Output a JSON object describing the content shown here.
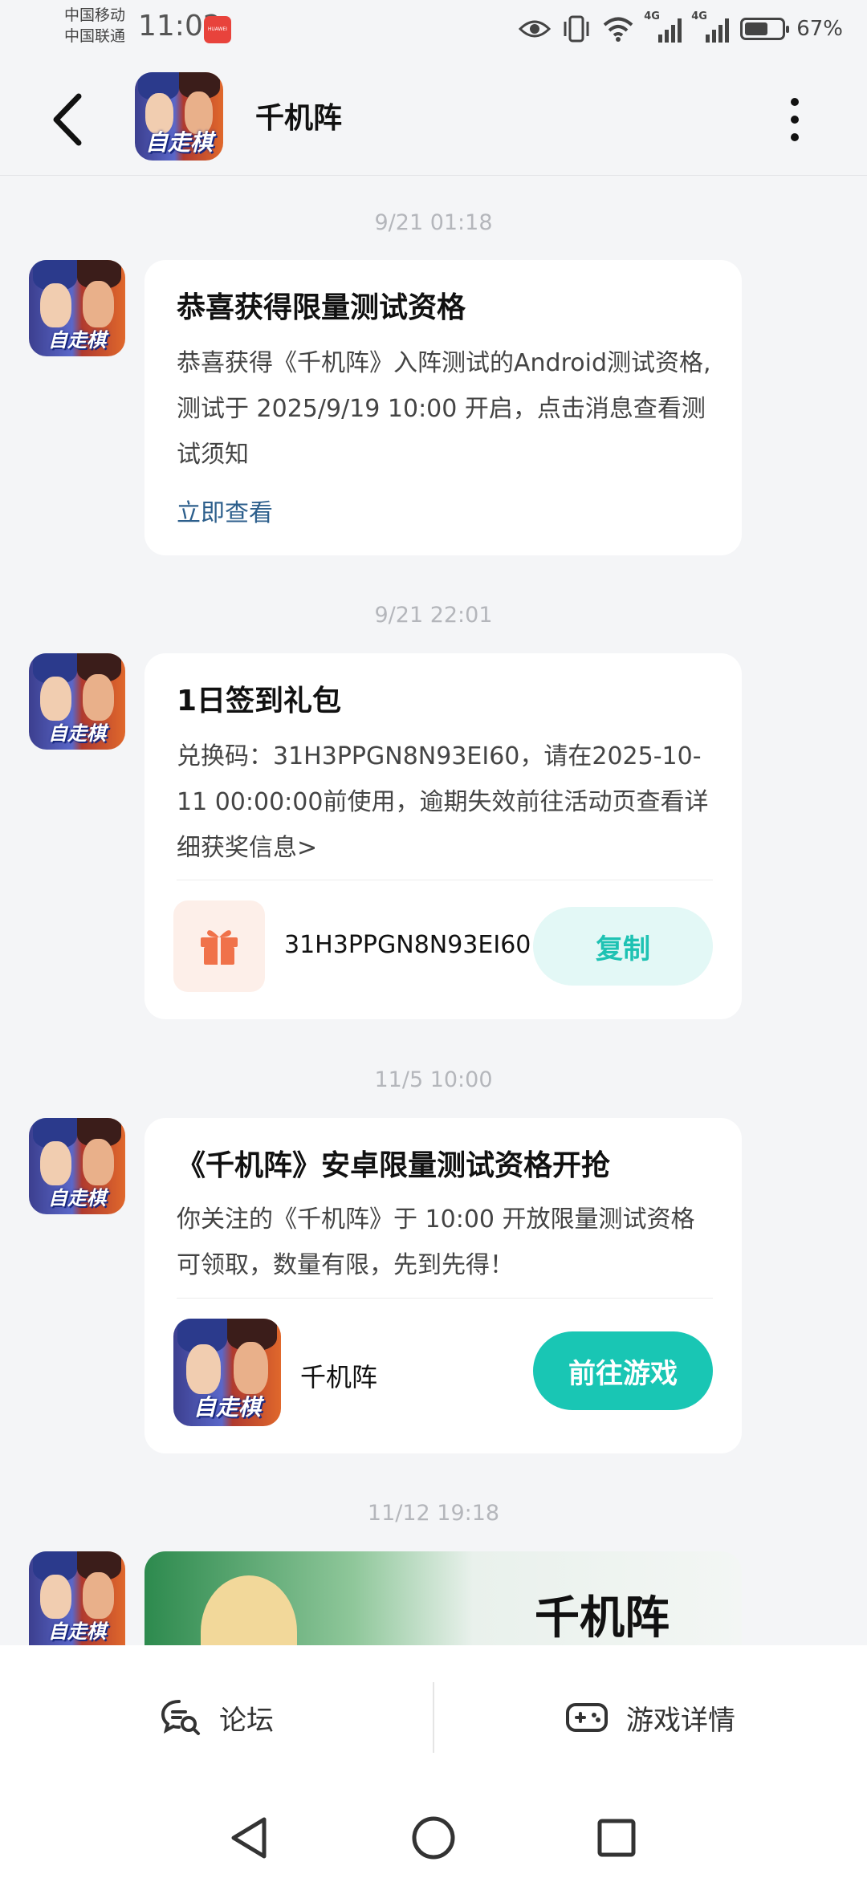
{
  "status_bar": {
    "carrier_1": "中国移动",
    "carrier_2": "中国联通",
    "time": "11:02",
    "badge": "HUAWEI",
    "network_1": "4G",
    "network_2": "4G",
    "battery": "67%",
    "battery_level": 0.67
  },
  "header": {
    "title": "千机阵",
    "icon_text": "自走棋"
  },
  "messages": [
    {
      "timestamp": "9/21  01:18",
      "title": "恭喜获得限量测试资格",
      "body": "恭喜获得《千机阵》入阵测试的Android测试资格,测试于 2025/9/19 10:00 开启，点击消息查看测试须知",
      "link": "立即查看"
    },
    {
      "timestamp": "9/21  22:01",
      "title": "1日签到礼包",
      "body": "兑换码：31H3PPGN8N93EI60，请在2025-10-11 00:00:00前使用，逾期失效前往活动页查看详细获奖信息>",
      "code": "31H3PPGN8N93EI60",
      "button": "复制"
    },
    {
      "timestamp": "11/5  10:00",
      "title": "《千机阵》安卓限量测试资格开抢",
      "body": "你关注的《千机阵》于 10:00 开放限量测试资格可领取，数量有限，先到先得！",
      "game_name": "千机阵",
      "button": "前往游戏"
    },
    {
      "timestamp": "11/12  19:18",
      "banner_text": "千机阵"
    }
  ],
  "bottom_bar": {
    "forum": "论坛",
    "game_details": "游戏详情"
  },
  "colors": {
    "accent": "#19c6b4",
    "link": "#2d5f8c",
    "background": "#f4f5f7"
  }
}
